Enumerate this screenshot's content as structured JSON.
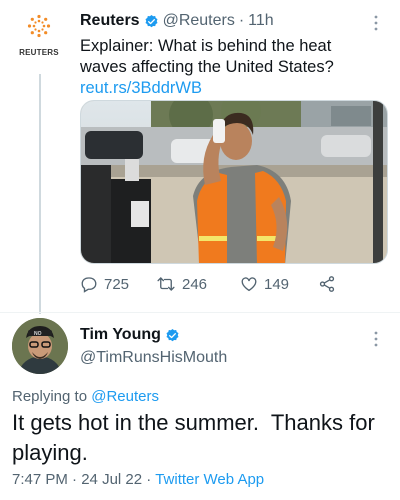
{
  "parent_tweet": {
    "logo_text": "REUTERS",
    "author_name": "Reuters",
    "handle": "@Reuters",
    "separator": "·",
    "time": "11h",
    "text": "Explainer: What is behind the heat waves affecting the United States?",
    "link": "reut.rs/3BddrWB",
    "actions": {
      "replies": "725",
      "retweets": "246",
      "likes": "149"
    }
  },
  "reply_tweet": {
    "author_name": "Tim Young",
    "handle": "@TimRunsHisMouth",
    "replying_prefix": "Replying to",
    "replying_to": "@Reuters",
    "text": "It gets hot in the summer.  Thanks for playing.",
    "time": "7:47 PM",
    "date": "24 Jul 22",
    "source": "Twitter Web App"
  },
  "colors": {
    "link": "#1d9bf0",
    "secondary": "#536471",
    "primary": "#0f1419",
    "divider": "#eff3f4"
  },
  "icons": [
    "reuters-logo",
    "verified-badge-icon",
    "more-icon",
    "reply-icon",
    "retweet-icon",
    "like-icon",
    "share-icon"
  ]
}
